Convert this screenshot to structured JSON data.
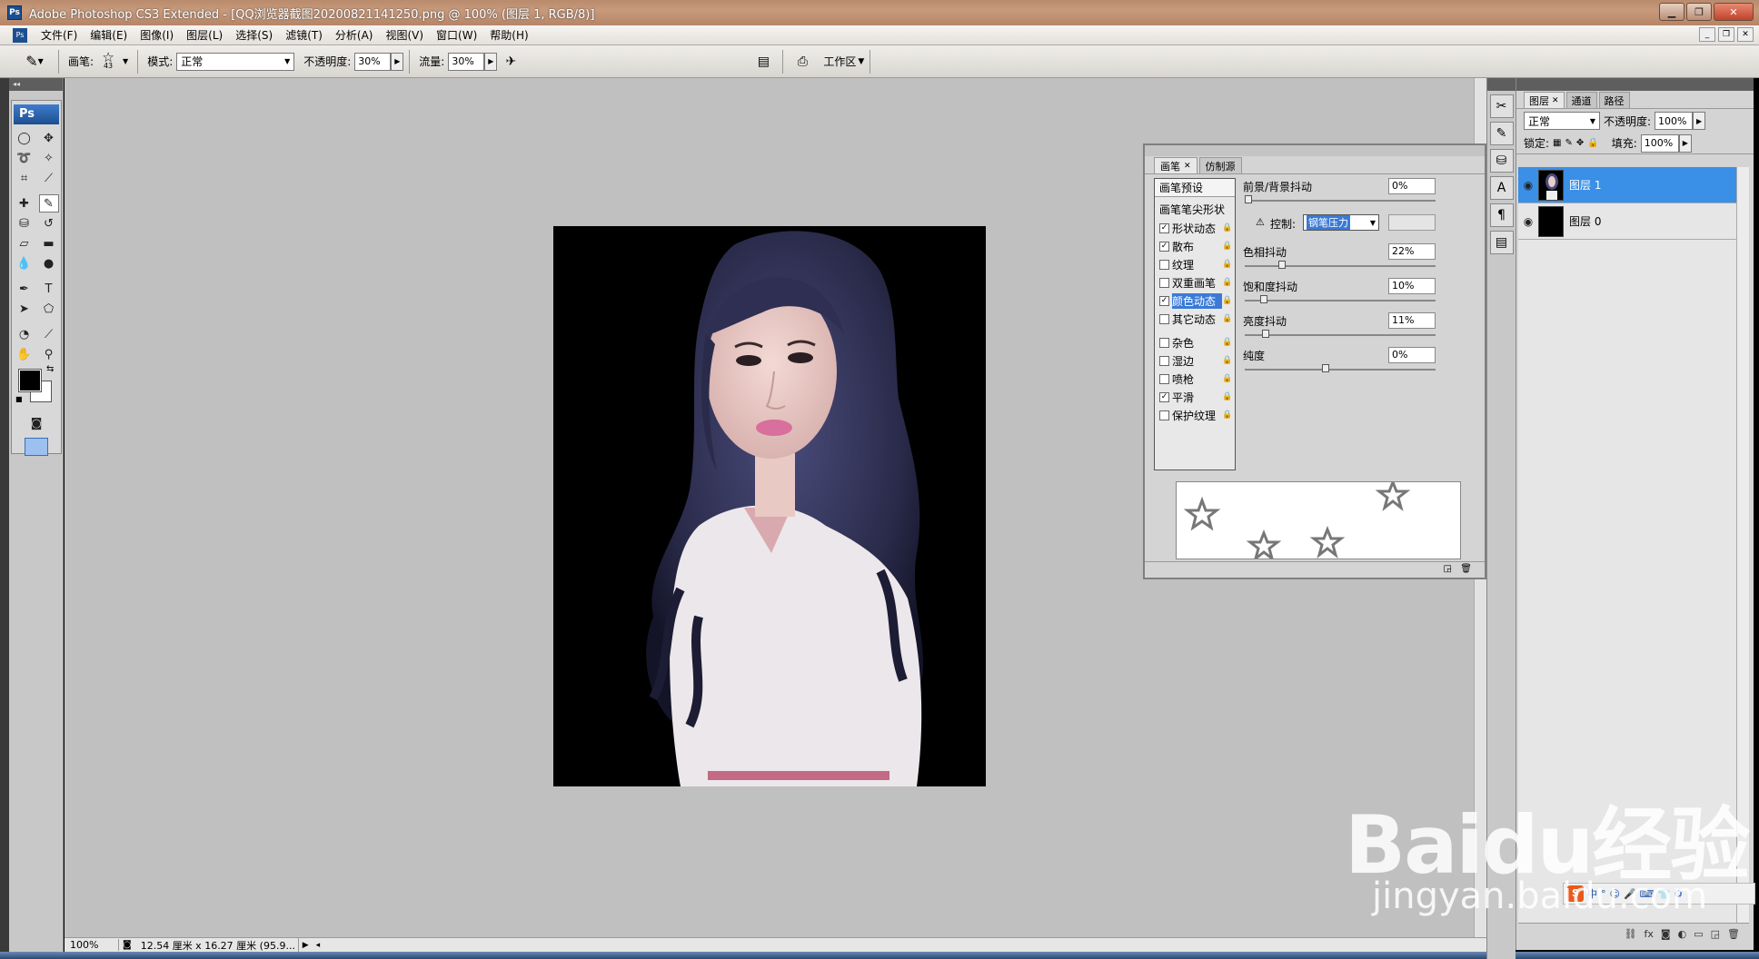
{
  "window": {
    "title": "Adobe Photoshop CS3 Extended - [QQ浏览器截图20200821141250.png @ 100% (图层 1, RGB/8)]",
    "app_icon": "Ps"
  },
  "menu": [
    "文件(F)",
    "编辑(E)",
    "图像(I)",
    "图层(L)",
    "选择(S)",
    "滤镜(T)",
    "分析(A)",
    "视图(V)",
    "窗口(W)",
    "帮助(H)"
  ],
  "options": {
    "brush_label": "画笔:",
    "brush_size": "43",
    "mode_label": "模式:",
    "mode_value": "正常",
    "opacity_label": "不透明度:",
    "opacity_value": "30%",
    "flow_label": "流量:",
    "flow_value": "30%",
    "workspace_label": "工作区"
  },
  "toolbox": {
    "logo": "Ps"
  },
  "status": {
    "zoom": "100%",
    "doc_info": "12.54 厘米 x 16.27 厘米 (95.9..."
  },
  "brush_panel": {
    "tabs": [
      "画笔",
      "仿制源"
    ],
    "preset": "画笔预设",
    "tip_shape": "画笔笔尖形状",
    "options": [
      {
        "label": "形状动态",
        "checked": true
      },
      {
        "label": "散布",
        "checked": true
      },
      {
        "label": "纹理",
        "checked": false
      },
      {
        "label": "双重画笔",
        "checked": false
      },
      {
        "label": "颜色动态",
        "checked": true,
        "selected": true
      },
      {
        "label": "其它动态",
        "checked": false
      },
      {
        "label": "杂色",
        "checked": false
      },
      {
        "label": "湿边",
        "checked": false
      },
      {
        "label": "喷枪",
        "checked": false
      },
      {
        "label": "平滑",
        "checked": true
      },
      {
        "label": "保护纹理",
        "checked": false
      }
    ],
    "fg_bg_jitter": {
      "label": "前景/背景抖动",
      "value": "0%",
      "level": 0.0
    },
    "control_label": "控制:",
    "control_value": "钢笔压力",
    "hue_jitter": {
      "label": "色相抖动",
      "value": "22%",
      "level": 0.22
    },
    "saturation_jitter": {
      "label": "饱和度抖动",
      "value": "10%",
      "level": 0.1
    },
    "brightness_jitter": {
      "label": "亮度抖动",
      "value": "11%",
      "level": 0.11
    },
    "purity": {
      "label": "纯度",
      "value": "0%",
      "level": 0.5
    }
  },
  "layers_panel": {
    "tabs": [
      "图层",
      "通道",
      "路径"
    ],
    "blend_mode": "正常",
    "opacity_label": "不透明度:",
    "opacity_value": "100%",
    "lock_label": "锁定:",
    "fill_label": "填充:",
    "fill_value": "100%",
    "layers": [
      {
        "name": "图层 1",
        "selected": true
      },
      {
        "name": "图层 0",
        "selected": false
      }
    ]
  },
  "watermark": {
    "main": "Baidu经验",
    "sub": "jingyan.baidu.com"
  },
  "ime": {
    "logo": "S",
    "text": "中"
  }
}
